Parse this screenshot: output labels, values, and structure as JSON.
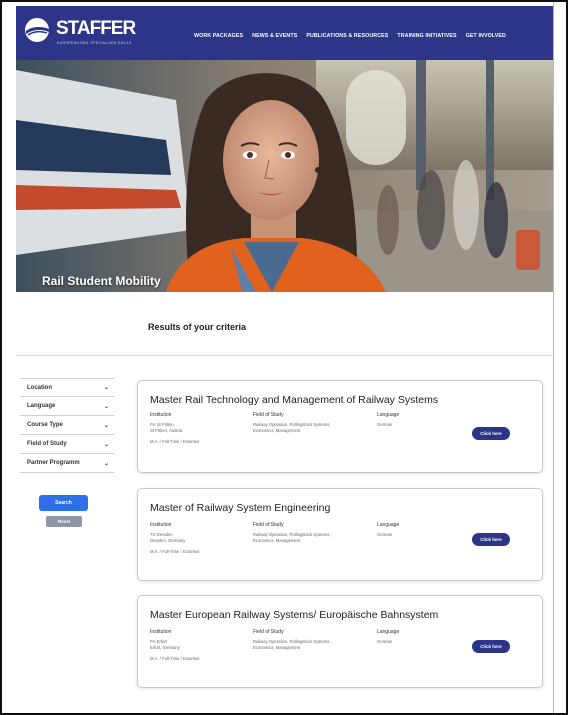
{
  "header": {
    "logo_text": "STAFFER",
    "logo_tagline": "EUROPEAN RAIL SPECIALISED SKILLS",
    "nav": [
      "WORK PACKAGES",
      "NEWS & EVENTS",
      "PUBLICATIONS & RESOURCES",
      "TRAINING INITIATIVES",
      "GET INVOLVED"
    ]
  },
  "hero": {
    "title": "Rail Student Mobility"
  },
  "results_title": "Results of your criteria",
  "filters": [
    "Location",
    "Language",
    "Course Type",
    "Field of Study",
    "Partner Programm"
  ],
  "buttons": {
    "search": "Search",
    "reset": "Reset"
  },
  "column_labels": {
    "institution": "Institution",
    "field": "Field of Study",
    "language": "Language"
  },
  "cards": [
    {
      "title": "Master Rail Technology and Management of Railway Systems",
      "institution": "FH St Pölten",
      "location": "St Pölten, Austria",
      "mode": "M.A. / Full-Time / Erasmus",
      "field": "Railway Operation, Rollingstock Systems, Economics, Management",
      "language": "German",
      "cta": "Click here"
    },
    {
      "title": "Master of Railway System Engineering",
      "institution": "TU Dresden",
      "location": "Dresden, Germany",
      "mode": "M.A. / Full-Time / Erasmus",
      "field": "Railway Operation, Rollingstock Systems, Economics, Management",
      "language": "German",
      "cta": "Click here"
    },
    {
      "title": "Master European Railway Systems/ Europäische Bahnsystem",
      "institution": "FH Erfurt",
      "location": "Erfurt, Germany",
      "mode": "M.A. / Full-Time / Erasmus",
      "field": "Railway Operation, Rollingstock Systems, Economics, Management",
      "language": "German",
      "cta": "Click here"
    }
  ],
  "colors": {
    "brand": "#2c3588",
    "search": "#2d6fe8",
    "reset": "#8e95a3"
  }
}
